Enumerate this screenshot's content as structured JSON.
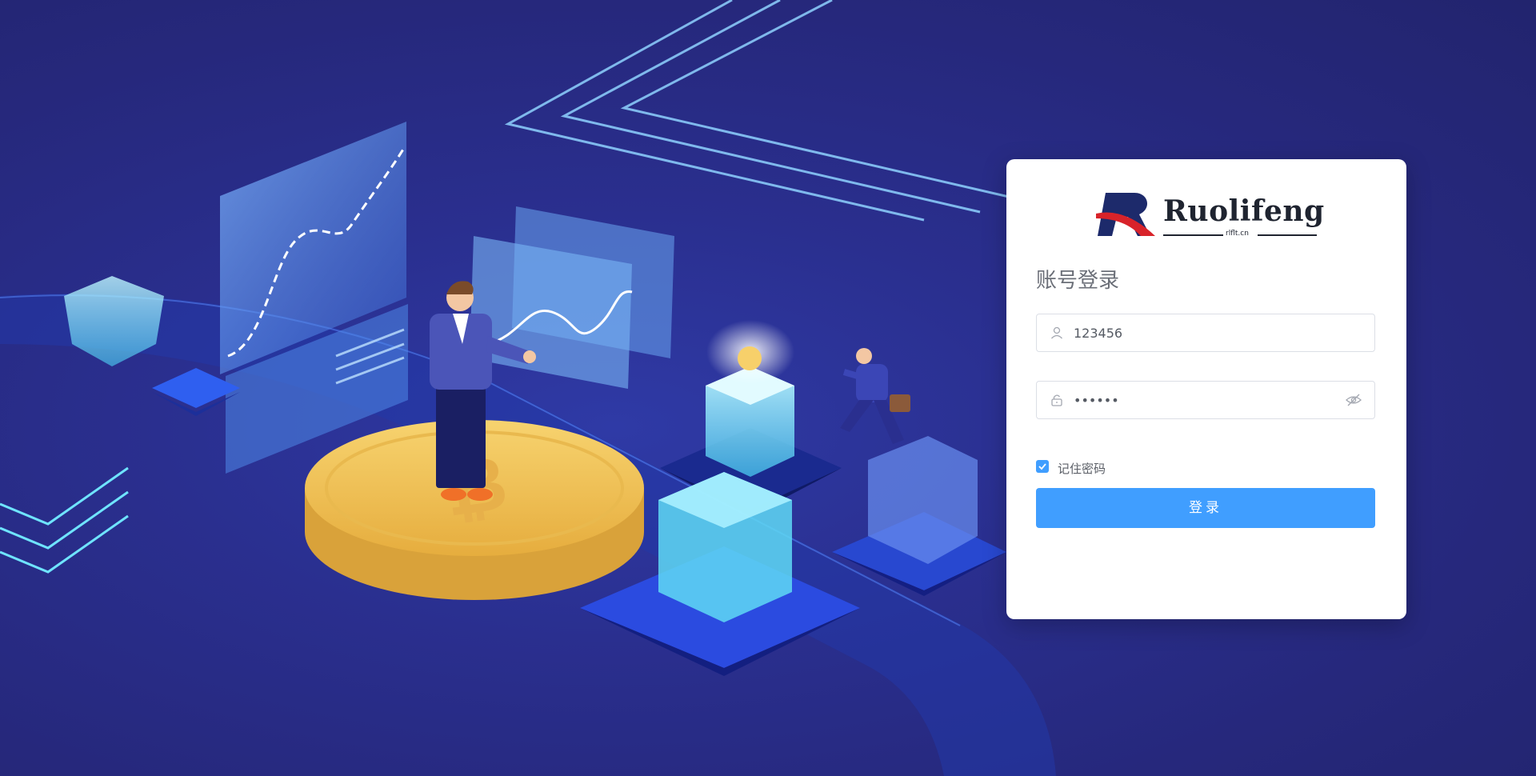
{
  "brand": {
    "name": "Ruolifeng",
    "domain": "rlflt.cn",
    "colors": {
      "navy": "#1d2a6b",
      "red": "#d8232a"
    }
  },
  "login": {
    "title": "账号登录",
    "username": {
      "value": "123456",
      "icon": "user-icon"
    },
    "password": {
      "value": "••••••",
      "icon": "lock-icon",
      "toggle_icon": "eye-hidden-icon"
    },
    "remember": {
      "label": "记住密码",
      "checked": true
    },
    "submit_label": "登录"
  },
  "colors": {
    "background": "#2a2f8f",
    "accent": "#409eff",
    "coin": "#f2c45c",
    "glow": "#7fe3ff"
  }
}
